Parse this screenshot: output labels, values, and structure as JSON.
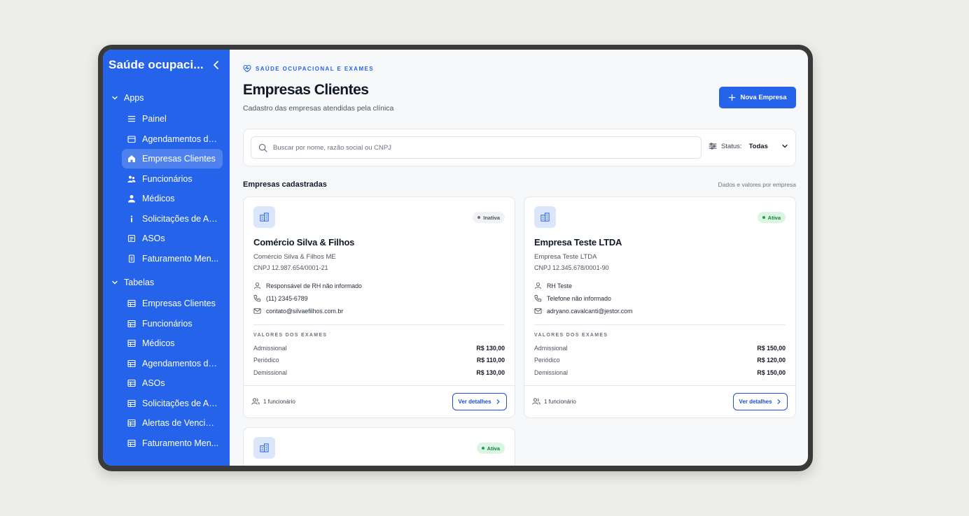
{
  "sidebar": {
    "title": "Saúde ocupaci...",
    "sections": [
      {
        "label": "Apps",
        "items": [
          {
            "label": "Painel",
            "icon": "list-icon"
          },
          {
            "label": "Agendamentos de...",
            "icon": "calendar-icon"
          },
          {
            "label": "Empresas Clientes",
            "icon": "home-icon",
            "active": true
          },
          {
            "label": "Funcionários",
            "icon": "users-icon"
          },
          {
            "label": "Médicos",
            "icon": "user-icon"
          },
          {
            "label": "Solicitações de Ag...",
            "icon": "info-icon"
          },
          {
            "label": "ASOs",
            "icon": "document-icon"
          },
          {
            "label": "Faturamento Men...",
            "icon": "receipt-icon"
          }
        ]
      },
      {
        "label": "Tabelas",
        "items": [
          {
            "label": "Empresas Clientes",
            "icon": "table-icon"
          },
          {
            "label": "Funcionários",
            "icon": "table-icon"
          },
          {
            "label": "Médicos",
            "icon": "table-icon"
          },
          {
            "label": "Agendamentos de...",
            "icon": "table-icon"
          },
          {
            "label": "ASOs",
            "icon": "table-icon"
          },
          {
            "label": "Solicitações de Ag...",
            "icon": "table-icon"
          },
          {
            "label": "Alertas de Vencim...",
            "icon": "table-icon"
          },
          {
            "label": "Faturamento Men...",
            "icon": "table-icon"
          }
        ]
      }
    ]
  },
  "header": {
    "eyebrow": "SAÚDE OCUPACIONAL E EXAMES",
    "title": "Empresas Clientes",
    "subtitle": "Cadastro das empresas atendidas pela clínica",
    "new_button": "Nova Empresa"
  },
  "filters": {
    "search_placeholder": "Buscar por nome, razão social ou CNPJ",
    "search_value": "",
    "status_label": "Status:",
    "status_value": "Todas"
  },
  "list": {
    "title": "Empresas cadastradas",
    "note": "Dados e valores por empresa"
  },
  "cards": [
    {
      "name": "Comércio Silva & Filhos",
      "legal_name": "Comércio Silva & Filhos ME",
      "cnpj": "CNPJ 12.987.654/0001-21",
      "status": "Inativa",
      "status_type": "inactive",
      "contact": "Responsável de RH não informado",
      "phone": "(11) 2345-6789",
      "email": "contato@silvaefilhos.com.br",
      "values_title": "VALORES DOS EXAMES",
      "values": [
        {
          "label": "Admissional",
          "value": "R$ 130,00"
        },
        {
          "label": "Periódico",
          "value": "R$ 110,00"
        },
        {
          "label": "Demissional",
          "value": "R$ 130,00"
        }
      ],
      "employees": "1 funcionário",
      "details_button": "Ver detalhes"
    },
    {
      "name": "Empresa Teste LTDA",
      "legal_name": "Empresa Teste LTDA",
      "cnpj": "CNPJ 12.345.678/0001-90",
      "status": "Ativa",
      "status_type": "active",
      "contact": "RH Teste",
      "phone": "Telefone não informado",
      "email": "adryano.cavalcanti@jestor.com",
      "values_title": "VALORES DOS EXAMES",
      "values": [
        {
          "label": "Admissional",
          "value": "R$ 150,00"
        },
        {
          "label": "Periódico",
          "value": "R$ 120,00"
        },
        {
          "label": "Demissional",
          "value": "R$ 150,00"
        }
      ],
      "employees": "1 funcionário",
      "details_button": "Ver detalhes"
    },
    {
      "status": "Ativa",
      "status_type": "active"
    }
  ],
  "colors": {
    "accent": "#2563eb",
    "active_badge": "#15803d",
    "inactive_badge": "#4b5563"
  }
}
